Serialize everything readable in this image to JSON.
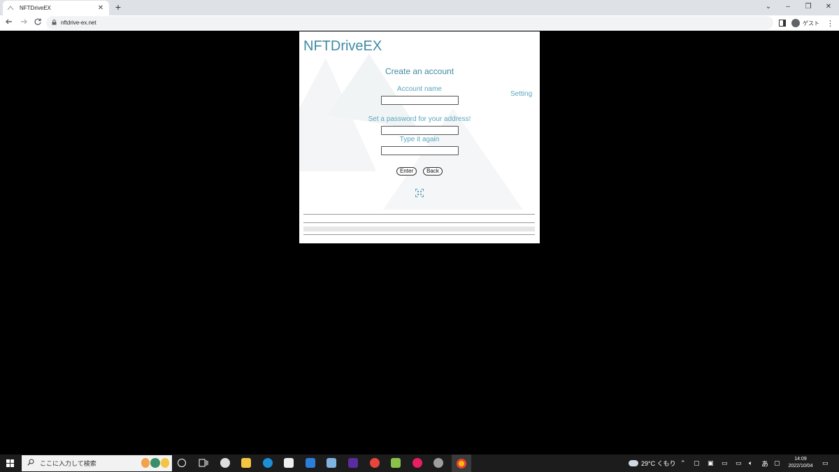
{
  "browser": {
    "tab_title": "NFTDriveEX",
    "tab_close": "✕",
    "new_tab": "+",
    "url": "nftdrive-ex.net",
    "profile_label": "ゲスト",
    "minimize": "–",
    "restore": "❐",
    "close": "✕",
    "tab_search": "⌄",
    "menu": "⋮"
  },
  "app": {
    "brand": "NFTDriveEX",
    "setting_link": "Setting",
    "heading": "Create an account",
    "account_name_label": "Account name",
    "account_name_value": "",
    "password_label": "Set a password for your address!",
    "password_value": "",
    "confirm_label": "Type it again",
    "confirm_value": "",
    "enter_button": "Enter",
    "back_button": "Back"
  },
  "taskbar": {
    "search_placeholder": "ここに入力して検索",
    "weather": "29°C くもり",
    "ime": "あ",
    "time": "14:09",
    "date": "2022/10/04"
  },
  "colors": {
    "accent": "#3f8aa3",
    "label": "#5aa6be",
    "page_bg": "#000000"
  }
}
